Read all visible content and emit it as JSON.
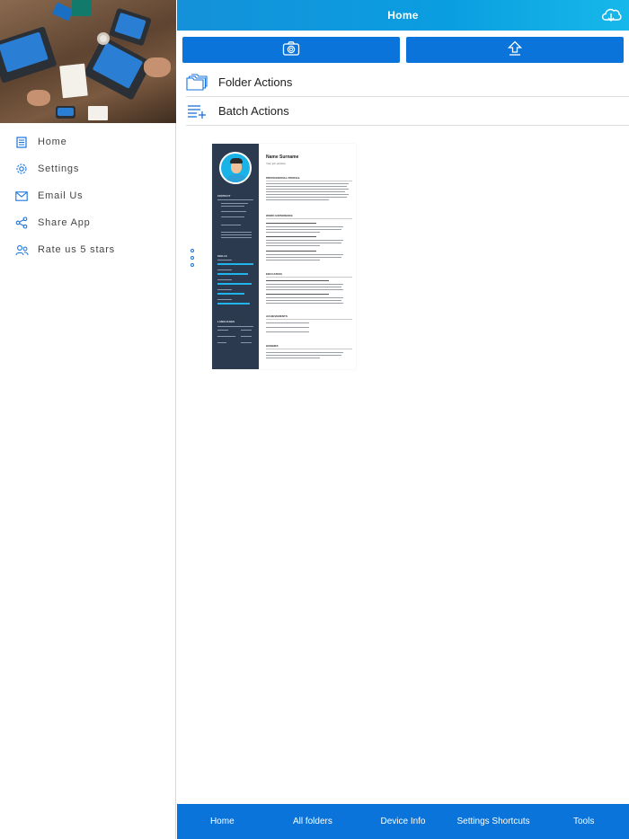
{
  "sidebar": {
    "items": [
      {
        "label": "Home",
        "icon": "document-icon"
      },
      {
        "label": "Settings",
        "icon": "gear-icon"
      },
      {
        "label": "Email Us",
        "icon": "mail-icon"
      },
      {
        "label": "Share App",
        "icon": "share-icon"
      },
      {
        "label": "Rate us 5 stars",
        "icon": "users-icon"
      }
    ]
  },
  "topbar": {
    "title": "Home"
  },
  "actions": {
    "camera_icon": "camera-icon",
    "upload_icon": "upload-icon"
  },
  "rows": [
    {
      "label": "Folder Actions",
      "icon": "folders-icon"
    },
    {
      "label": "Batch Actions",
      "icon": "batch-list-icon"
    }
  ],
  "document": {
    "name": "Name Surname",
    "job_title": "Your job position",
    "section_headers": [
      "PROFESSIONAL PROFILE",
      "WORK EXPERIENCE",
      "EDUCATION",
      "ACHIEVEMENTS",
      "HOBBIES"
    ],
    "sidebar_headers": [
      "CONTACT",
      "SKILLS",
      "LANGUAGES"
    ]
  },
  "tabs": [
    {
      "label": "Home",
      "active": true
    },
    {
      "label": "All folders",
      "active": false
    },
    {
      "label": "Device Info",
      "active": false
    },
    {
      "label": "Settings Shortcuts",
      "active": false
    },
    {
      "label": "Tools",
      "active": false
    }
  ],
  "colors": {
    "accent": "#0a74da",
    "header_gradient_end": "#17b8ea",
    "icon_blue": "#1a73d9"
  }
}
